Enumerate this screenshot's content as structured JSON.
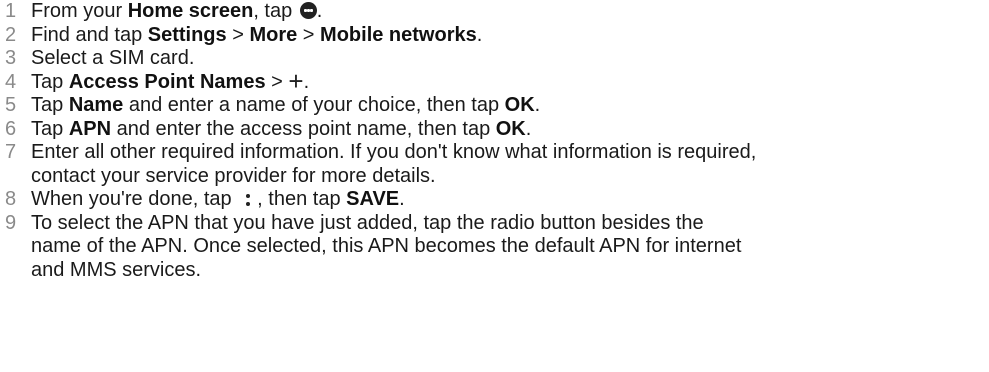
{
  "steps": [
    {
      "num": "1",
      "t1": "From your ",
      "b1": "Home screen",
      "t2": ", tap ",
      "icon": "apps-icon",
      "t3": "."
    },
    {
      "num": "2",
      "t1": "Find and tap ",
      "b1": "Settings",
      "t2": " > ",
      "b2": "More",
      "t3": " > ",
      "b3": "Mobile networks",
      "t4": "."
    },
    {
      "num": "3",
      "t1": "Select a SIM card."
    },
    {
      "num": "4",
      "t1": "Tap ",
      "b1": "Access Point Names",
      "t2": " > ",
      "icon": "plus-icon",
      "t3": "."
    },
    {
      "num": "5",
      "t1": "Tap ",
      "b1": "Name",
      "t2": " and enter a name of your choice, then tap ",
      "b2": "OK",
      "t3": "."
    },
    {
      "num": "6",
      "t1": "Tap ",
      "b1": "APN",
      "t2": " and enter the access point name, then tap ",
      "b2": "OK",
      "t3": "."
    },
    {
      "num": "7",
      "line1": "Enter all other required information. If you don't know what information is required,",
      "line2": "contact your service provider for more details."
    },
    {
      "num": "8",
      "t1": "When you're done, tap ",
      "icon": "more-vert-icon",
      "t2": ", then tap ",
      "b1": "SAVE",
      "t3": "."
    },
    {
      "num": "9",
      "line1": "To select the APN that you have just added, tap the radio button besides the",
      "line2": "name of the APN. Once selected, this APN becomes the default APN for internet",
      "line3": "and MMS services."
    }
  ]
}
